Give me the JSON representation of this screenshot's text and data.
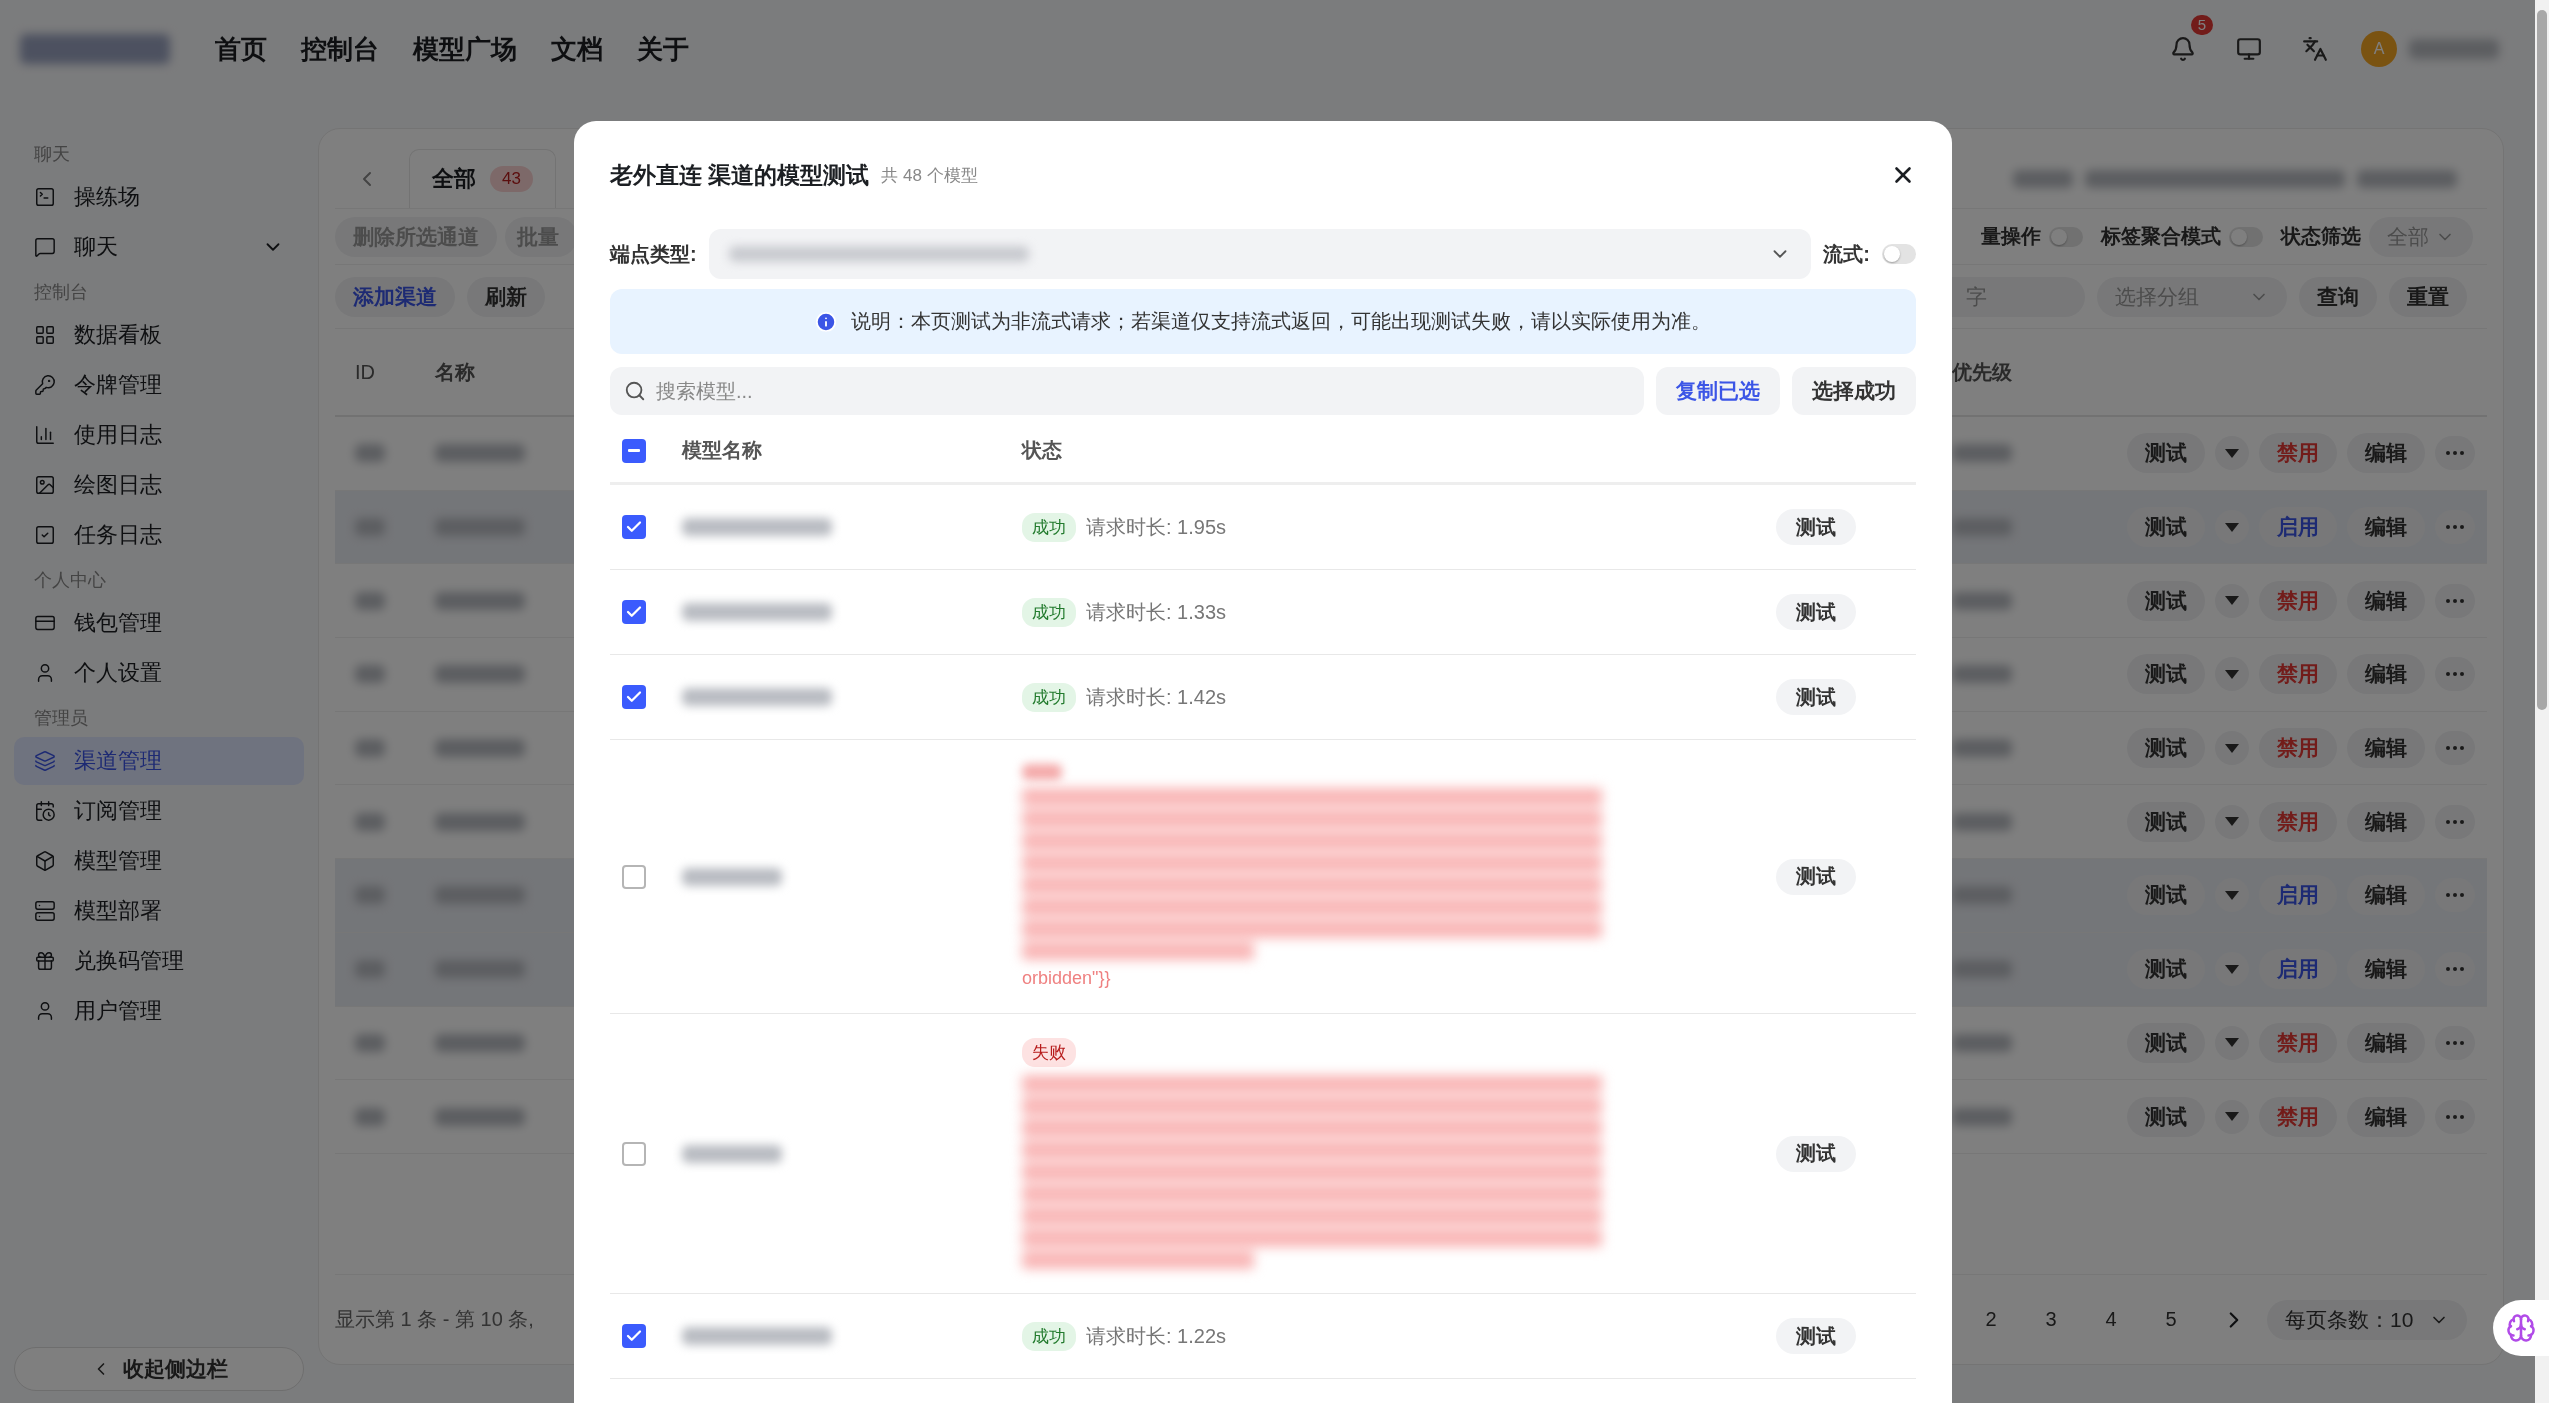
{
  "header": {
    "nav": [
      {
        "label": "首页"
      },
      {
        "label": "控制台"
      },
      {
        "label": "模型广场"
      },
      {
        "label": "文档"
      },
      {
        "label": "关于"
      }
    ],
    "notification_count": "5",
    "avatar": "A"
  },
  "sidebar": {
    "sections": [
      {
        "title": "聊天",
        "items": [
          {
            "label": "操练场",
            "selected": false
          },
          {
            "label": "聊天",
            "selected": false,
            "expandable": true
          }
        ]
      },
      {
        "title": "控制台",
        "items": [
          {
            "label": "数据看板",
            "selected": false
          },
          {
            "label": "令牌管理",
            "selected": false
          },
          {
            "label": "使用日志",
            "selected": false
          },
          {
            "label": "绘图日志",
            "selected": false
          },
          {
            "label": "任务日志",
            "selected": false
          }
        ]
      },
      {
        "title": "个人中心",
        "items": [
          {
            "label": "钱包管理",
            "selected": false
          },
          {
            "label": "个人设置",
            "selected": false
          }
        ]
      },
      {
        "title": "管理员",
        "items": [
          {
            "label": "渠道管理",
            "selected": true
          },
          {
            "label": "订阅管理",
            "selected": false
          },
          {
            "label": "模型管理",
            "selected": false
          },
          {
            "label": "模型部署",
            "selected": false
          },
          {
            "label": "兑换码管理",
            "selected": false
          },
          {
            "label": "用户管理",
            "selected": false
          }
        ]
      }
    ],
    "collapse": "收起侧边栏"
  },
  "channels": {
    "tab": {
      "label": "全部",
      "count": "43",
      "selected": true
    },
    "toolbar_left_1": [
      "删除所选通道",
      "批量"
    ],
    "batch": {
      "label": "量操作",
      "on": false
    },
    "tag_mode": {
      "label": "标签聚合模式",
      "on": false
    },
    "status_filter": {
      "label": "状态筛选",
      "value": "全部"
    },
    "toolbar_left_2": [
      {
        "label": "添加渠道",
        "kind": "primary"
      },
      {
        "label": "刷新",
        "kind": "plain"
      }
    ],
    "search_tail": "字",
    "group_select": "选择分组",
    "query": "查询",
    "reset": "重置",
    "columns": {
      "id": "ID",
      "name": "名称",
      "priority": "优先级"
    },
    "rows": [
      {
        "disabled": false,
        "actions": [
          "测试",
          "禁用",
          "编辑"
        ]
      },
      {
        "disabled": true,
        "actions": [
          "测试",
          "启用",
          "编辑"
        ]
      },
      {
        "disabled": false,
        "actions": [
          "测试",
          "禁用",
          "编辑"
        ]
      },
      {
        "disabled": false,
        "actions": [
          "测试",
          "禁用",
          "编辑"
        ]
      },
      {
        "disabled": false,
        "actions": [
          "测试",
          "禁用",
          "编辑"
        ]
      },
      {
        "disabled": false,
        "actions": [
          "测试",
          "禁用",
          "编辑"
        ]
      },
      {
        "disabled": true,
        "actions": [
          "测试",
          "启用",
          "编辑"
        ]
      },
      {
        "disabled": true,
        "actions": [
          "测试",
          "启用",
          "编辑"
        ]
      },
      {
        "disabled": false,
        "actions": [
          "测试",
          "禁用",
          "编辑"
        ]
      },
      {
        "disabled": false,
        "actions": [
          "测试",
          "禁用",
          "编辑"
        ]
      }
    ],
    "range": "显示第 1 条 - 第 10 条,",
    "pages": [
      "2",
      "3",
      "4",
      "5"
    ],
    "page_size": "每页条数：10"
  },
  "dialog": {
    "title": "老外直连 渠道的模型测试",
    "subtitle": "共 48 个模型",
    "endpoint_label": "端点类型:",
    "stream_label": "流式:",
    "stream_on": false,
    "notice": "说明：本页测试为非流式请求；若渠道仅支持流式返回，可能出现测试失败，请以实际使用为准。",
    "search_placeholder": "搜索模型...",
    "copy_selected": "复制已选",
    "select_success": "选择成功",
    "columns": {
      "name": "模型名称",
      "status": "状态"
    },
    "header_checkbox": {
      "indeterminate": true
    },
    "rows": [
      {
        "kind": "success",
        "checked": true,
        "badge": "成功",
        "duration": "请求时长: 1.95s",
        "test": "测试"
      },
      {
        "kind": "success",
        "checked": true,
        "badge": "成功",
        "duration": "请求时长: 1.33s",
        "test": "测试"
      },
      {
        "kind": "success",
        "checked": true,
        "badge": "成功",
        "duration": "请求时长: 1.42s",
        "test": "测试"
      },
      {
        "kind": "error",
        "checked": false,
        "error_tail": "orbidden\"}}",
        "test": "测试"
      },
      {
        "kind": "error",
        "checked": false,
        "badge": "失败",
        "test": "测试"
      },
      {
        "kind": "success",
        "checked": true,
        "badge": "成功",
        "duration": "请求时长: 1.22s",
        "test": "测试"
      }
    ]
  }
}
